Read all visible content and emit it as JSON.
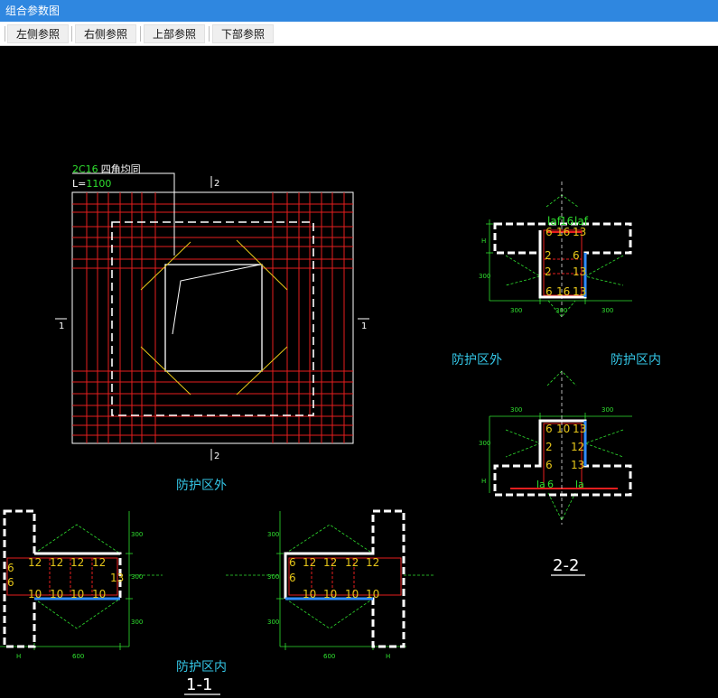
{
  "window": {
    "title": "组合参数图"
  },
  "toolbar": {
    "buttons": [
      {
        "label": "左侧参照"
      },
      {
        "label": "右侧参照"
      },
      {
        "label": "上部参照"
      },
      {
        "label": "下部参照"
      }
    ]
  },
  "plan": {
    "rebar_note_part1": "2C16",
    "rebar_note_part2": "四角均同",
    "length_prefix": "L=",
    "length_value": "1100",
    "section_mark_1": "1",
    "section_mark_2": "2"
  },
  "labels": {
    "outside_zone": "防护区外",
    "inside_zone": "防护区内",
    "section_1": "1-1",
    "section_2": "2-2"
  },
  "dims": {
    "d300": "300",
    "d600": "600",
    "dH": "H"
  },
  "bars": {
    "b12": "12",
    "b10": "10",
    "b16": "16",
    "b6": "6",
    "b13": "13",
    "b2": "2",
    "laf": "laf",
    "la": "la"
  },
  "colors": {
    "grid_red": "#e61e1e",
    "diag_yellow": "#e6c619",
    "annotation_green": "#2fe02f",
    "label_cyan": "#34c6e6",
    "face_blue": "#2f8cff",
    "title_blue": "#2f87e0"
  }
}
